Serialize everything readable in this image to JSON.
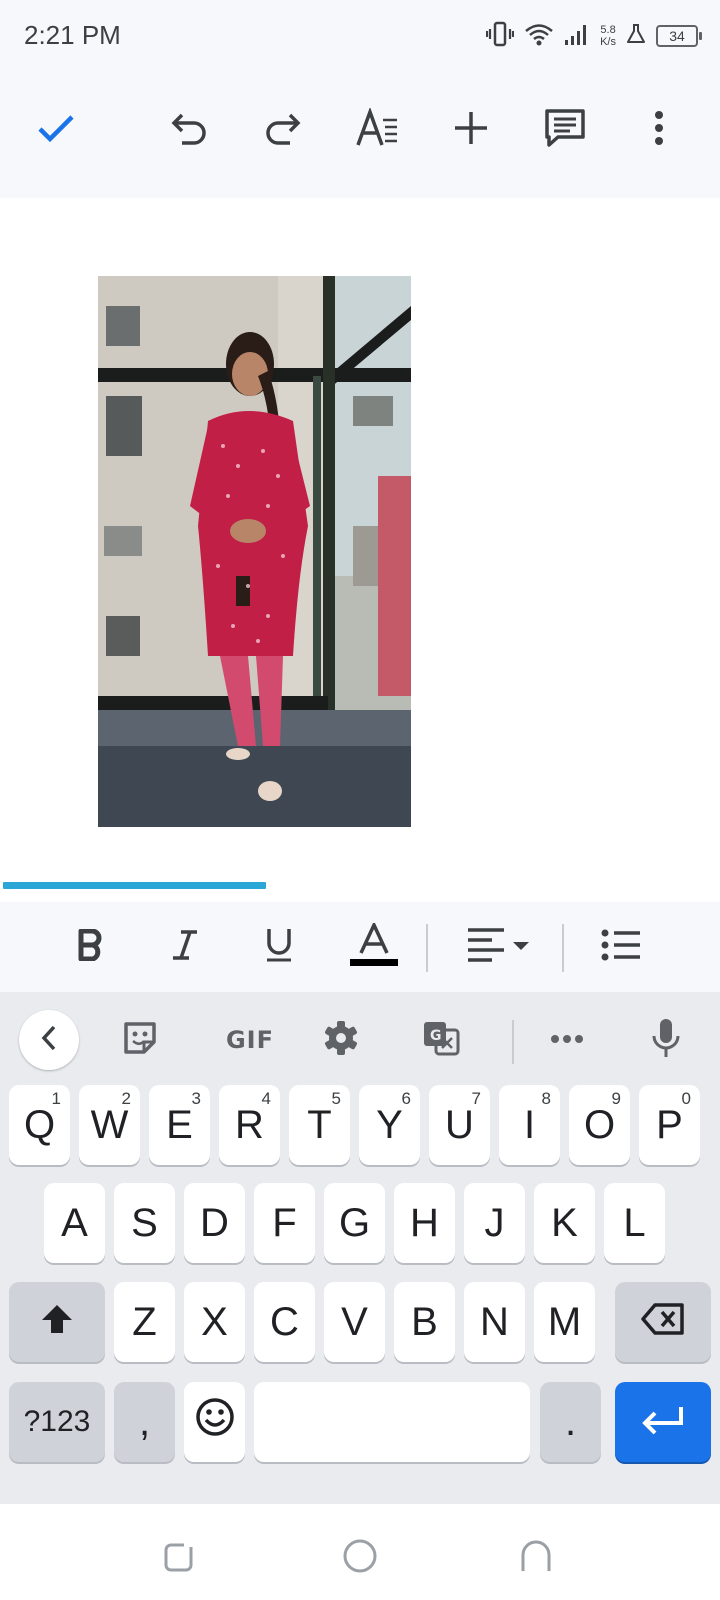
{
  "status_bar": {
    "time": "2:21 PM",
    "net_speed_value": "5.8",
    "net_speed_unit": "K/s",
    "battery": "34"
  },
  "toolbar": {
    "icons": [
      "check-icon",
      "undo-icon",
      "redo-icon",
      "text-format-icon",
      "add-icon",
      "comment-icon",
      "more-vert-icon"
    ]
  },
  "document": {
    "inline_image": "photo-of-woman-in-red-kurta",
    "load_progress": 0.37
  },
  "format_bar": {
    "icons": [
      "bold-icon",
      "italic-icon",
      "underline-icon",
      "text-color-icon",
      "align-left-icon",
      "bulleted-list-icon"
    ],
    "text_color": "#000000"
  },
  "keyboard": {
    "toolbar": {
      "gif_label": "GIF",
      "icons": [
        "back-chevron-icon",
        "sticker-icon",
        "gear-icon",
        "translate-icon",
        "more-icon",
        "mic-icon"
      ]
    },
    "row1": [
      {
        "key": "Q",
        "hint": "1"
      },
      {
        "key": "W",
        "hint": "2"
      },
      {
        "key": "E",
        "hint": "3"
      },
      {
        "key": "R",
        "hint": "4"
      },
      {
        "key": "T",
        "hint": "5"
      },
      {
        "key": "Y",
        "hint": "6"
      },
      {
        "key": "U",
        "hint": "7"
      },
      {
        "key": "I",
        "hint": "8"
      },
      {
        "key": "O",
        "hint": "9"
      },
      {
        "key": "P",
        "hint": "0"
      }
    ],
    "row2": [
      "A",
      "S",
      "D",
      "F",
      "G",
      "H",
      "J",
      "K",
      "L"
    ],
    "row3": [
      "Z",
      "X",
      "C",
      "V",
      "B",
      "N",
      "M"
    ],
    "symbols_label": "?123",
    "comma": ",",
    "period": ".",
    "accent_color": "#1a73e8"
  },
  "nav_bar": {
    "icons": [
      "recents-icon",
      "home-icon",
      "back-icon"
    ]
  }
}
